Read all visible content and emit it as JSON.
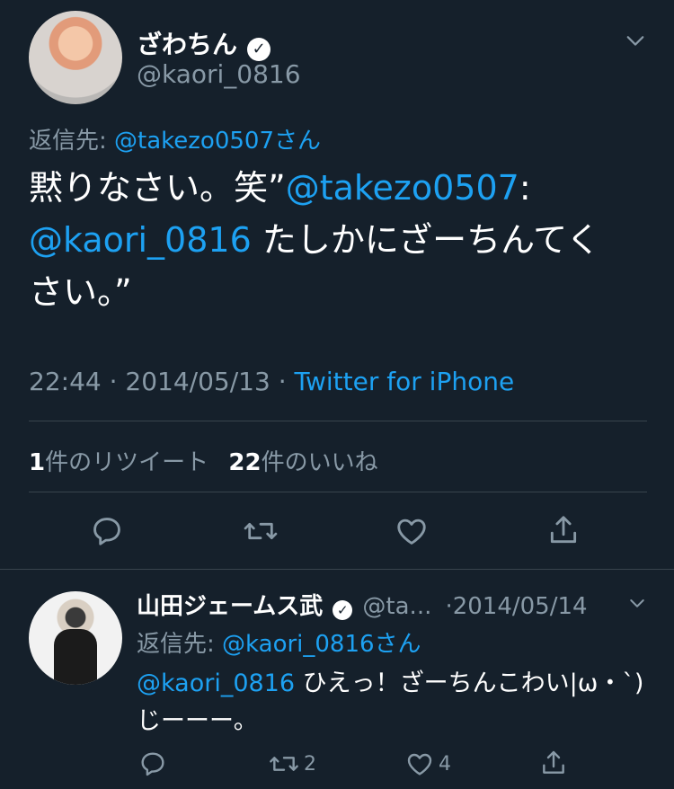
{
  "tweet": {
    "author_name": "ざわちん",
    "handle": "@kaori_0816",
    "reply_prefix": "返信先:",
    "reply_to": "@takezo0507さん",
    "text_line1_a": "黙りなさい。笑”",
    "text_line1_mention": "@takezo0507",
    "text_line1_b": ":",
    "text_line2_mention": "@kaori_0816",
    "text_line2_b": " たしかにざーちんてく",
    "text_line3": "さい。”",
    "time": "22:44",
    "sep": "·",
    "date": "2014/05/13",
    "client": "Twitter for iPhone",
    "retweets_count": "1",
    "retweets_label": "件のリツイート",
    "likes_count": "22",
    "likes_label": "件のいいね"
  },
  "reply": {
    "author_name": "山田ジェームス武",
    "handle": "@ta...",
    "date": "·2014/05/14",
    "reply_prefix": "返信先:",
    "reply_to": "@kaori_0816さん",
    "text_mention": "@kaori_0816",
    "text_a": " ひえっ！ざーちんこわい|ω・`)",
    "text_b": "じーーー。",
    "retweet_count": "2",
    "like_count": "4"
  },
  "icons": [
    "verified-icon",
    "chevron-down-icon",
    "reply-icon",
    "retweet-icon",
    "like-icon",
    "share-icon"
  ],
  "colors": {
    "background": "#15202b",
    "accent": "#1da1f2",
    "muted": "#8899a6",
    "divider": "#38444d"
  }
}
